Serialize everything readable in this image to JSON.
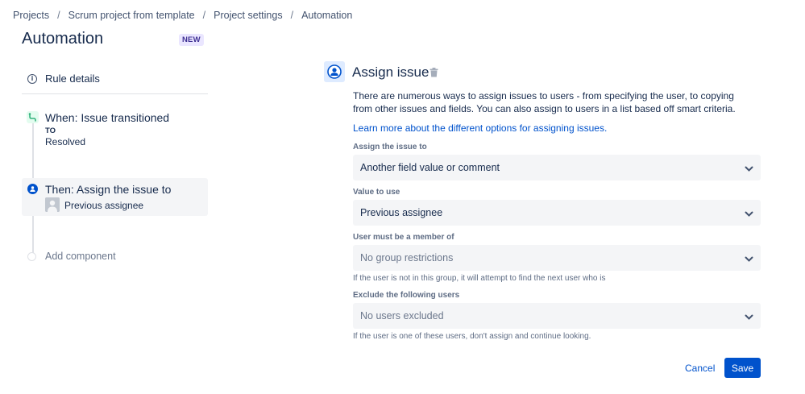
{
  "breadcrumb": {
    "items": [
      "Projects",
      "Scrum project from template",
      "Project settings",
      "Automation"
    ],
    "separator": "/"
  },
  "header": {
    "title": "Automation",
    "badge": "NEW"
  },
  "sidebar": {
    "rule_details": {
      "label": "Rule details",
      "icon": "info-icon"
    },
    "trigger": {
      "title": "When: Issue transitioned",
      "to_label": "TO",
      "status": "Resolved",
      "icon": "transition-icon",
      "color": "#36b37e"
    },
    "action": {
      "title": "Then: Assign the issue to",
      "value": "Previous assignee",
      "icon": "assignee-icon"
    },
    "add_component": {
      "label": "Add component"
    }
  },
  "panel": {
    "title": "Assign issue",
    "icon": "assignee-icon",
    "delete_icon": "trash-icon",
    "description": "There are numerous ways to assign issues to users - from specifying the user, to copying from other issues and fields. You can also assign to users in a list based off smart criteria.",
    "learn_more": "Learn more about the different options for assigning issues.",
    "fields": {
      "assign_to": {
        "label": "Assign the issue to",
        "value": "Another field value or comment"
      },
      "value_to_use": {
        "label": "Value to use",
        "value": "Previous assignee"
      },
      "member_of": {
        "label": "User must be a member of",
        "placeholder": "No group restrictions",
        "help": "If the user is not in this group, it will attempt to find the next user who is"
      },
      "exclude": {
        "label": "Exclude the following users",
        "placeholder": "No users excluded",
        "help": "If the user is one of these users, don't assign and continue looking."
      }
    },
    "buttons": {
      "cancel": "Cancel",
      "save": "Save"
    }
  },
  "colors": {
    "primary": "#0052cc",
    "text": "#172b4d",
    "muted": "#6b778c",
    "field_bg": "#f4f5f7",
    "badge_bg": "#eae6ff",
    "badge_text": "#403294"
  }
}
